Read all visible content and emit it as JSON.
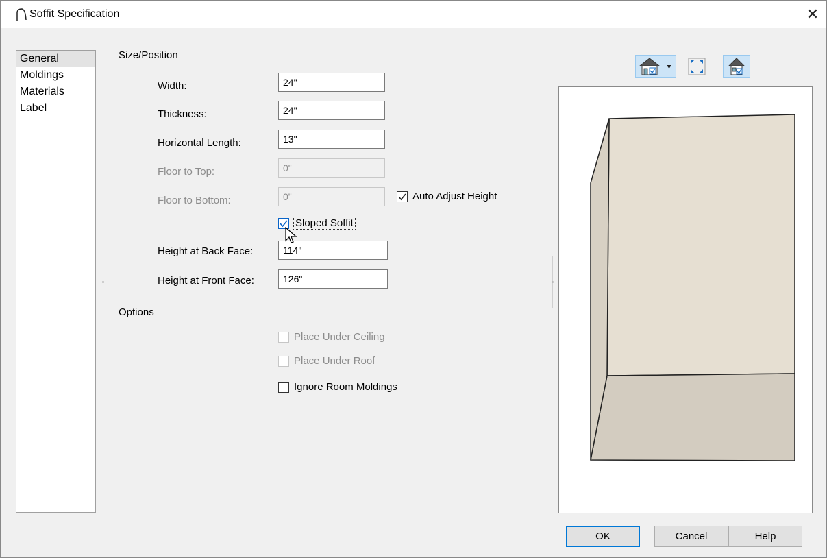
{
  "window": {
    "title": "Soffit Specification"
  },
  "nav": {
    "items": [
      "General",
      "Moldings",
      "Materials",
      "Label"
    ],
    "selected": "General"
  },
  "size_position": {
    "section_title": "Size/Position",
    "width": {
      "label": "Width:",
      "value": "24\""
    },
    "thickness": {
      "label": "Thickness:",
      "value": "24\""
    },
    "horizontal_length": {
      "label": "Horizontal Length:",
      "value": "13\""
    },
    "floor_to_top": {
      "label": "Floor to Top:",
      "value": "0\"",
      "disabled": true
    },
    "floor_to_bottom": {
      "label": "Floor to Bottom:",
      "value": "0\"",
      "disabled": true
    },
    "auto_adjust_height": {
      "label": "Auto Adjust Height",
      "checked": true
    },
    "sloped_soffit": {
      "label": "Sloped Soffit",
      "checked": true
    },
    "height_back_face": {
      "label": "Height at Back Face:",
      "value": "114\""
    },
    "height_front_face": {
      "label": "Height at Front Face:",
      "value": "126\""
    }
  },
  "options": {
    "section_title": "Options",
    "place_under_ceiling": {
      "label": "Place Under Ceiling",
      "checked": false,
      "disabled": true
    },
    "place_under_roof": {
      "label": "Place Under Roof",
      "checked": false,
      "disabled": true
    },
    "ignore_room_moldings": {
      "label": "Ignore Room Moldings",
      "checked": false
    }
  },
  "preview_toolbar": {
    "icons": [
      "camera-view-icon",
      "fit-to-window-icon",
      "show-room-icon"
    ]
  },
  "buttons": {
    "ok": "OK",
    "cancel": "Cancel",
    "help": "Help"
  },
  "colors": {
    "accent": "#0078d7",
    "soffit_face": "#e6dfd2",
    "soffit_side": "#d3ccc0"
  }
}
